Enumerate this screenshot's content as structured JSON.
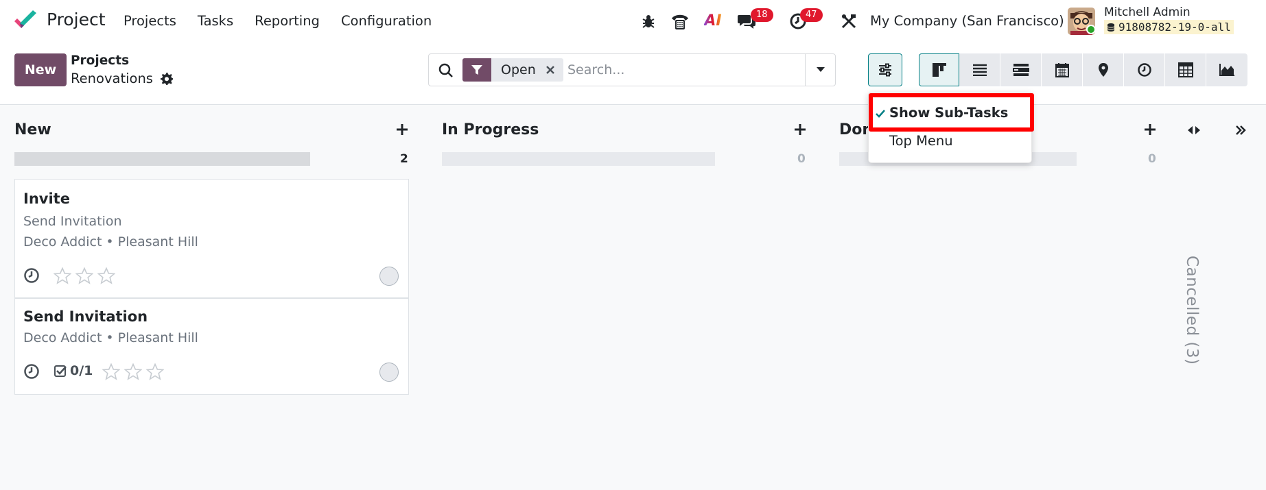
{
  "navbar": {
    "app_name": "Project",
    "menu": [
      "Projects",
      "Tasks",
      "Reporting",
      "Configuration"
    ],
    "badges": {
      "messages": "18",
      "activities": "47"
    },
    "ai_label": "AI",
    "company": "My Company (San Francisco)",
    "user": "Mitchell Admin",
    "database": "91808782-19-0-all"
  },
  "control_panel": {
    "new_label": "New",
    "breadcrumb_parent": "Projects",
    "breadcrumb_current": "Renovations",
    "filter_facet": "Open",
    "search_placeholder": "Search..."
  },
  "settings_dropdown": {
    "items": [
      {
        "label": "Show Sub-Tasks",
        "checked": true
      },
      {
        "label": "Top Menu",
        "checked": false
      }
    ]
  },
  "columns": [
    {
      "title": "New",
      "count": "2"
    },
    {
      "title": "In Progress",
      "count": "0"
    },
    {
      "title": "Done",
      "count": "0"
    }
  ],
  "folded_column": "Cancelled (3)",
  "cards": [
    {
      "title": "Invite",
      "subtitle": "Send Invitation",
      "meta": "Deco Addict • Pleasant Hill",
      "priority_stars": 0
    },
    {
      "title": "Send Invitation",
      "meta": "Deco Addict • Pleasant Hill",
      "checklist": "0/1",
      "priority_stars": 0
    }
  ],
  "colors": {
    "brand": "#714b67",
    "accent": "#017e84",
    "badge": "#e0182d",
    "highlight": "#ff0000"
  }
}
